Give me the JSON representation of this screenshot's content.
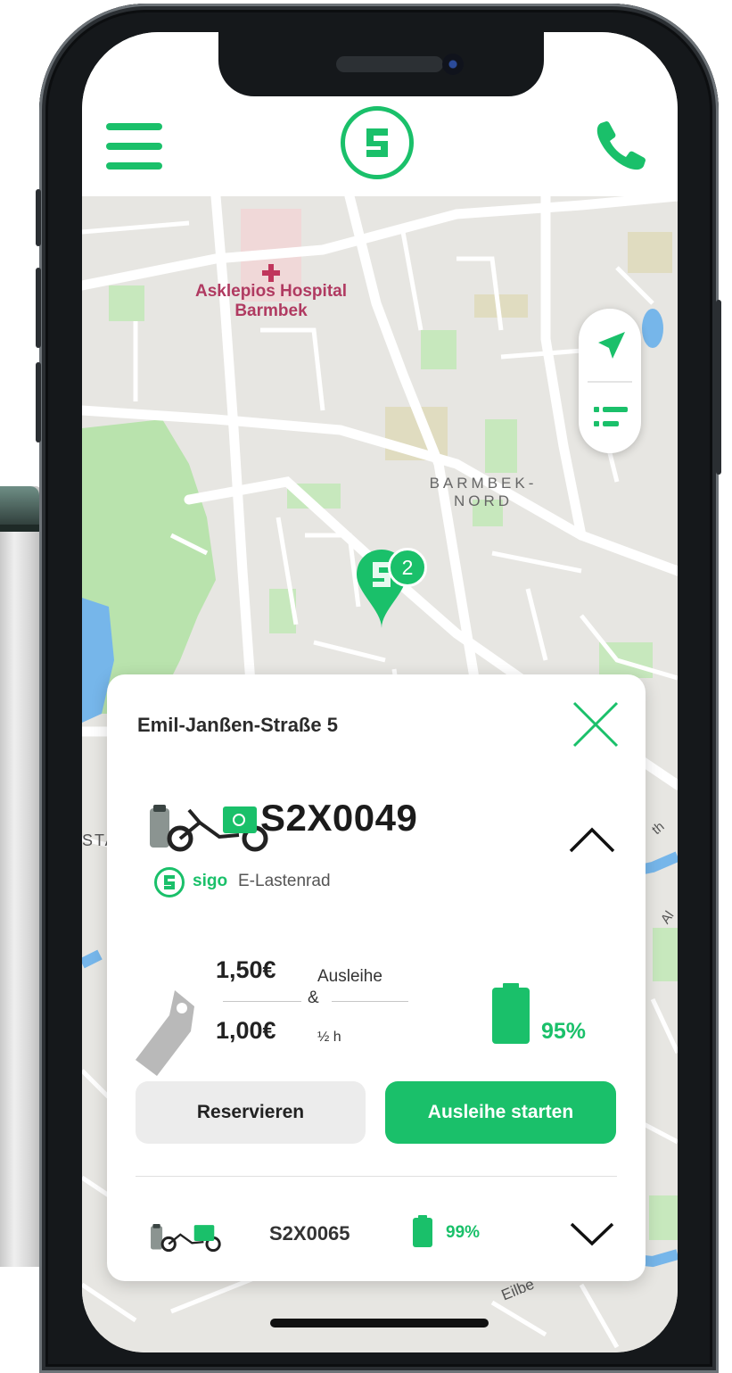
{
  "header": {
    "menu_icon": "hamburger-menu-icon",
    "logo_icon": "sigo-logo-icon",
    "call_icon": "phone-icon"
  },
  "map": {
    "poi_name": "Asklepios Hospital",
    "poi_name_line2": "Barmbek",
    "district_line1": "BARMBEK-",
    "district_line2": "NORD",
    "street_label_1": "Eilbe",
    "street_label_2": "Al",
    "street_label_3": "th",
    "street_label_4": "STA",
    "marker_count": "2",
    "controls": {
      "locate_icon": "navigation-arrow-icon",
      "list_icon": "list-icon"
    }
  },
  "station": {
    "address": "Emil-Janßen-Straße 5"
  },
  "vehicles": [
    {
      "id": "S2X0049",
      "brand": "sigo",
      "type": "E-Lastenrad",
      "price_rental": "1,50€",
      "price_rental_label": "Ausleihe",
      "joiner": "&",
      "price_half_hour": "1,00€",
      "price_half_hour_label": "½ h",
      "battery_percent": "95%",
      "battery_level": 0.95,
      "expanded": true
    },
    {
      "id": "S2X0065",
      "battery_percent": "99%",
      "battery_level": 0.99,
      "expanded": false
    }
  ],
  "actions": {
    "reserve_label": "Reservieren",
    "start_label": "Ausleihe starten"
  },
  "colors": {
    "brand_green": "#1ac06a",
    "poi_pink": "#b03a61",
    "map_background": "#e7e6e2",
    "park_green": "#b9e3ad",
    "water_blue": "#76b6ea"
  }
}
